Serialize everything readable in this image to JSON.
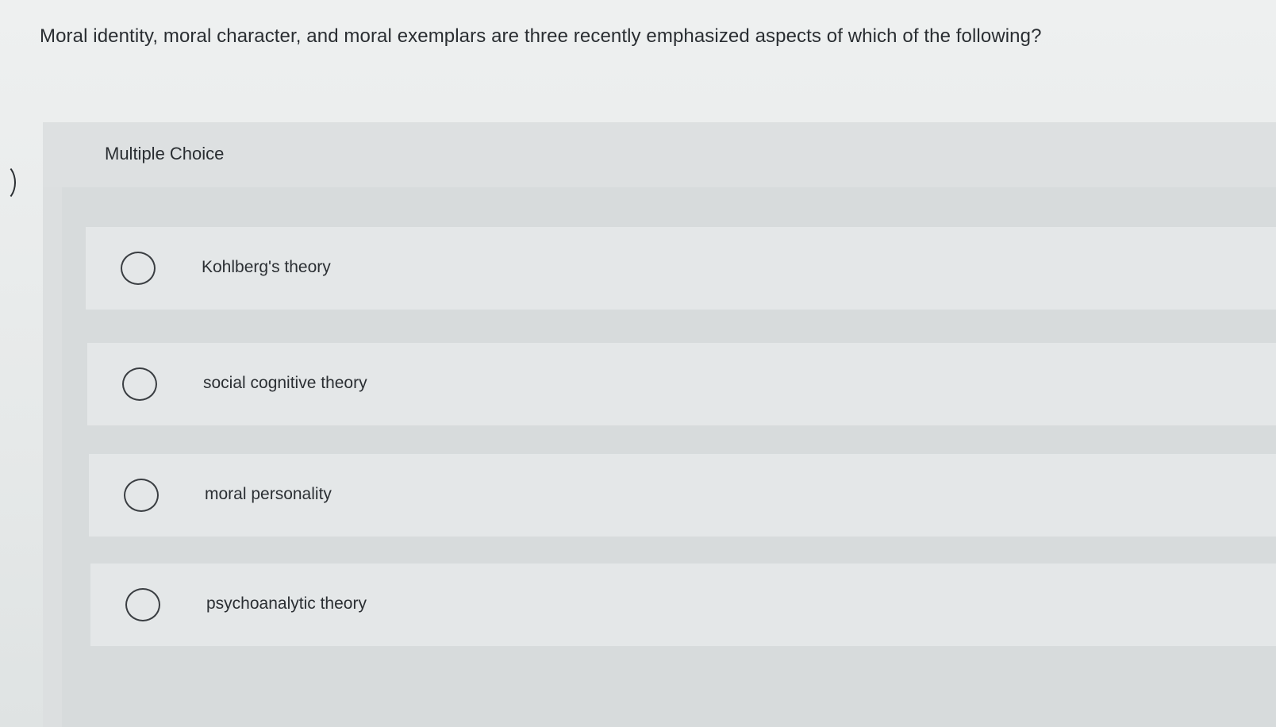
{
  "question": {
    "text": "Moral identity, moral character, and moral exemplars are three recently emphasized aspects of which of the following?"
  },
  "multiple_choice": {
    "title": "Multiple Choice",
    "selected": null,
    "options": [
      {
        "label": "Kohlberg's theory",
        "radio_icon": "radio-empty-icon"
      },
      {
        "label": "social cognitive theory",
        "radio_icon": "radio-empty-icon"
      },
      {
        "label": "moral personality",
        "radio_icon": "radio-empty-icon"
      },
      {
        "label": "psychoanalytic theory",
        "radio_icon": "radio-empty-icon"
      }
    ]
  },
  "colors": {
    "background": "#e9ecec",
    "panel": "#dcdfe0",
    "option_background": "#e4e7e8",
    "text": "#2b2f33"
  }
}
